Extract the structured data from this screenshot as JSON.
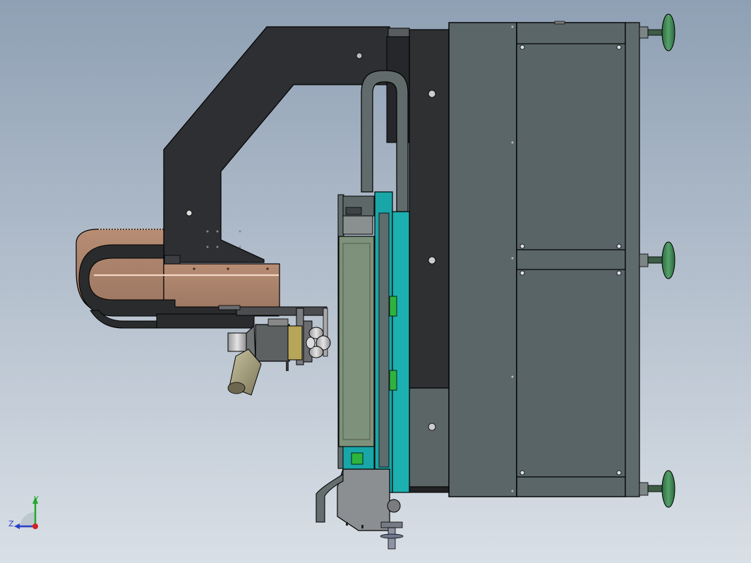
{
  "app": {
    "view": "cad-3d-viewport",
    "background": {
      "top": "#8fa0b4",
      "bottom": "#d9dfe6"
    }
  },
  "model": {
    "name": "",
    "parts": [
      "overhead-arm",
      "cable-carrier-drag-chain",
      "hose-loop",
      "process-head",
      "nozzle-cluster",
      "gear-motor",
      "linear-slide-carriage",
      "cyan-linear-guide",
      "main-column",
      "electrical-cabinet",
      "leveling-foot-top",
      "leveling-foot-middle",
      "leveling-foot-bottom",
      "bottom-bracket",
      "bottom-hose",
      "bottom-spindle"
    ],
    "colors": {
      "arm": "#2d2f32",
      "cabinet": "#5a6667",
      "drag_chain": "#a8806a",
      "guide": "#19a6a8",
      "carriage_panel": "#7e917b",
      "foot": "#3f8a55",
      "green_marker": "#2fb33f"
    }
  },
  "triad": {
    "axes": [
      {
        "label": "Y",
        "color": "#1faa2a",
        "icon": "y-axis-arrow"
      },
      {
        "label": "Z",
        "color": "#2840c8",
        "icon": "z-axis-arrow"
      },
      {
        "label": "",
        "color": "#d42020",
        "icon": "x-axis-dot"
      }
    ]
  }
}
